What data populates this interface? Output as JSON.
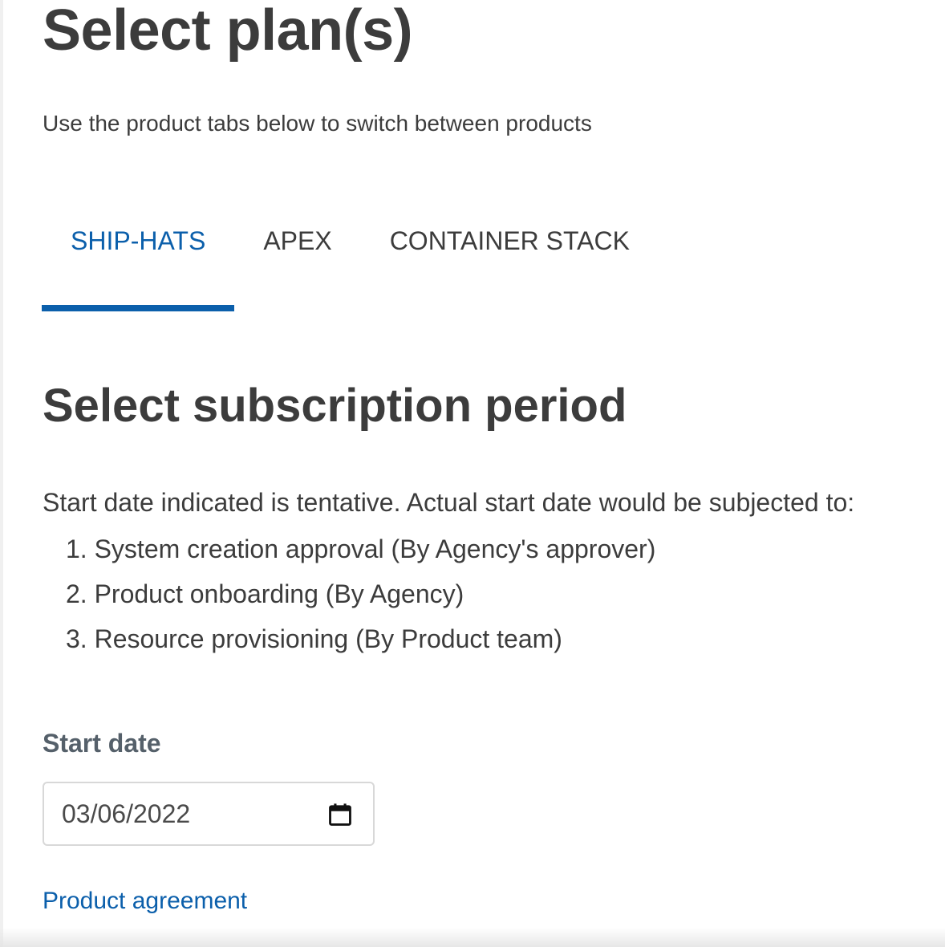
{
  "page": {
    "title": "Select plan(s)",
    "subtitle": "Use the product tabs below to switch between products"
  },
  "tabs": [
    {
      "label": "SHIP-HATS",
      "active": true
    },
    {
      "label": "APEX",
      "active": false
    },
    {
      "label": "CONTAINER STACK",
      "active": false
    }
  ],
  "subscription": {
    "title": "Select subscription period",
    "intro": "Start date indicated is tentative. Actual start date would be subjected to:",
    "steps": [
      "1. System creation approval (By Agency's approver)",
      "2. Product onboarding (By Agency)",
      "3. Resource provisioning (By Product team)"
    ],
    "start_date_label": "Start date",
    "start_date_value": "03/06/2022",
    "date_icon": "calendar-icon"
  },
  "links": {
    "product_agreement": "Product agreement"
  },
  "colors": {
    "accent": "#0b5fab",
    "text": "#3c3c3c",
    "label": "#55606a"
  }
}
